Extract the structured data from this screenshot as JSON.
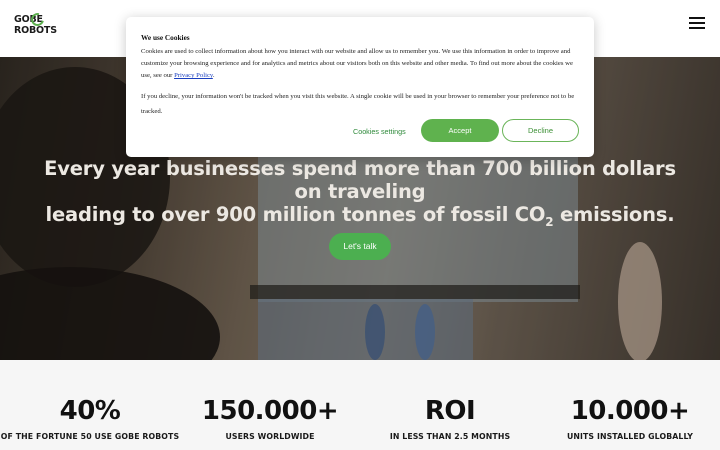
{
  "header": {
    "logo_line1": "GOBE",
    "logo_line2": "ROBOTS",
    "menu_icon": "hamburger-menu-icon"
  },
  "hero": {
    "title_line1": "Every year businesses spend more than 700 billion dollars on traveling",
    "title_line2_before": "leading to over 900 million tonnes of fossil CO",
    "title_line2_sub": "2",
    "title_line2_after": " emissions.",
    "cta_label": "Let's talk"
  },
  "cookie": {
    "title": "We use Cookies",
    "text_main": "Cookies are used to collect information about how you interact with our website and allow us to remember you. We use this information in order to improve and customize your browsing experience and for analytics and metrics about our visitors both on this website and other media. To find out more about the cookies we use, see our ",
    "policy_link": "Privacy Policy",
    "text_end": ".",
    "text_decline": "If you decline, your information won't be tracked when you visit this website. A single cookie will be used in your browser to remember your preference not to be tracked.",
    "settings_label": "Cookies settings",
    "accept_label": "Accept",
    "decline_label": "Decline"
  },
  "stats": [
    {
      "value": "40%",
      "label": "OF THE FORTUNE 50 USE GOBE ROBOTS"
    },
    {
      "value": "150.000+",
      "label": "USERS WORLDWIDE"
    },
    {
      "value": "ROI",
      "label": "IN LESS THAN 2.5 MONTHS"
    },
    {
      "value": "10.000+",
      "label": "UNITS INSTALLED GLOBALLY"
    }
  ],
  "colors": {
    "accent_green": "#4caf50",
    "link_blue": "#1a3fbf"
  }
}
